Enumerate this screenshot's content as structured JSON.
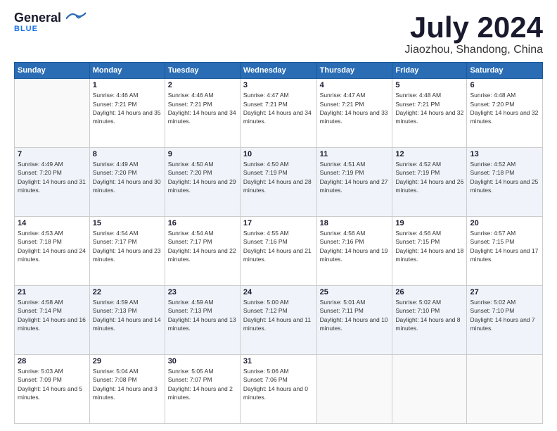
{
  "header": {
    "logo_general": "General",
    "logo_blue": "Blue",
    "month_title": "July 2024",
    "location": "Jiaozhou, Shandong, China"
  },
  "days_of_week": [
    "Sunday",
    "Monday",
    "Tuesday",
    "Wednesday",
    "Thursday",
    "Friday",
    "Saturday"
  ],
  "weeks": [
    [
      {
        "day": "",
        "sunrise": "",
        "sunset": "",
        "daylight": "",
        "empty": true
      },
      {
        "day": "1",
        "sunrise": "Sunrise: 4:46 AM",
        "sunset": "Sunset: 7:21 PM",
        "daylight": "Daylight: 14 hours and 35 minutes."
      },
      {
        "day": "2",
        "sunrise": "Sunrise: 4:46 AM",
        "sunset": "Sunset: 7:21 PM",
        "daylight": "Daylight: 14 hours and 34 minutes."
      },
      {
        "day": "3",
        "sunrise": "Sunrise: 4:47 AM",
        "sunset": "Sunset: 7:21 PM",
        "daylight": "Daylight: 14 hours and 34 minutes."
      },
      {
        "day": "4",
        "sunrise": "Sunrise: 4:47 AM",
        "sunset": "Sunset: 7:21 PM",
        "daylight": "Daylight: 14 hours and 33 minutes."
      },
      {
        "day": "5",
        "sunrise": "Sunrise: 4:48 AM",
        "sunset": "Sunset: 7:21 PM",
        "daylight": "Daylight: 14 hours and 32 minutes."
      },
      {
        "day": "6",
        "sunrise": "Sunrise: 4:48 AM",
        "sunset": "Sunset: 7:20 PM",
        "daylight": "Daylight: 14 hours and 32 minutes."
      }
    ],
    [
      {
        "day": "7",
        "sunrise": "Sunrise: 4:49 AM",
        "sunset": "Sunset: 7:20 PM",
        "daylight": "Daylight: 14 hours and 31 minutes."
      },
      {
        "day": "8",
        "sunrise": "Sunrise: 4:49 AM",
        "sunset": "Sunset: 7:20 PM",
        "daylight": "Daylight: 14 hours and 30 minutes."
      },
      {
        "day": "9",
        "sunrise": "Sunrise: 4:50 AM",
        "sunset": "Sunset: 7:20 PM",
        "daylight": "Daylight: 14 hours and 29 minutes."
      },
      {
        "day": "10",
        "sunrise": "Sunrise: 4:50 AM",
        "sunset": "Sunset: 7:19 PM",
        "daylight": "Daylight: 14 hours and 28 minutes."
      },
      {
        "day": "11",
        "sunrise": "Sunrise: 4:51 AM",
        "sunset": "Sunset: 7:19 PM",
        "daylight": "Daylight: 14 hours and 27 minutes."
      },
      {
        "day": "12",
        "sunrise": "Sunrise: 4:52 AM",
        "sunset": "Sunset: 7:19 PM",
        "daylight": "Daylight: 14 hours and 26 minutes."
      },
      {
        "day": "13",
        "sunrise": "Sunrise: 4:52 AM",
        "sunset": "Sunset: 7:18 PM",
        "daylight": "Daylight: 14 hours and 25 minutes."
      }
    ],
    [
      {
        "day": "14",
        "sunrise": "Sunrise: 4:53 AM",
        "sunset": "Sunset: 7:18 PM",
        "daylight": "Daylight: 14 hours and 24 minutes."
      },
      {
        "day": "15",
        "sunrise": "Sunrise: 4:54 AM",
        "sunset": "Sunset: 7:17 PM",
        "daylight": "Daylight: 14 hours and 23 minutes."
      },
      {
        "day": "16",
        "sunrise": "Sunrise: 4:54 AM",
        "sunset": "Sunset: 7:17 PM",
        "daylight": "Daylight: 14 hours and 22 minutes."
      },
      {
        "day": "17",
        "sunrise": "Sunrise: 4:55 AM",
        "sunset": "Sunset: 7:16 PM",
        "daylight": "Daylight: 14 hours and 21 minutes."
      },
      {
        "day": "18",
        "sunrise": "Sunrise: 4:56 AM",
        "sunset": "Sunset: 7:16 PM",
        "daylight": "Daylight: 14 hours and 19 minutes."
      },
      {
        "day": "19",
        "sunrise": "Sunrise: 4:56 AM",
        "sunset": "Sunset: 7:15 PM",
        "daylight": "Daylight: 14 hours and 18 minutes."
      },
      {
        "day": "20",
        "sunrise": "Sunrise: 4:57 AM",
        "sunset": "Sunset: 7:15 PM",
        "daylight": "Daylight: 14 hours and 17 minutes."
      }
    ],
    [
      {
        "day": "21",
        "sunrise": "Sunrise: 4:58 AM",
        "sunset": "Sunset: 7:14 PM",
        "daylight": "Daylight: 14 hours and 16 minutes."
      },
      {
        "day": "22",
        "sunrise": "Sunrise: 4:59 AM",
        "sunset": "Sunset: 7:13 PM",
        "daylight": "Daylight: 14 hours and 14 minutes."
      },
      {
        "day": "23",
        "sunrise": "Sunrise: 4:59 AM",
        "sunset": "Sunset: 7:13 PM",
        "daylight": "Daylight: 14 hours and 13 minutes."
      },
      {
        "day": "24",
        "sunrise": "Sunrise: 5:00 AM",
        "sunset": "Sunset: 7:12 PM",
        "daylight": "Daylight: 14 hours and 11 minutes."
      },
      {
        "day": "25",
        "sunrise": "Sunrise: 5:01 AM",
        "sunset": "Sunset: 7:11 PM",
        "daylight": "Daylight: 14 hours and 10 minutes."
      },
      {
        "day": "26",
        "sunrise": "Sunrise: 5:02 AM",
        "sunset": "Sunset: 7:10 PM",
        "daylight": "Daylight: 14 hours and 8 minutes."
      },
      {
        "day": "27",
        "sunrise": "Sunrise: 5:02 AM",
        "sunset": "Sunset: 7:10 PM",
        "daylight": "Daylight: 14 hours and 7 minutes."
      }
    ],
    [
      {
        "day": "28",
        "sunrise": "Sunrise: 5:03 AM",
        "sunset": "Sunset: 7:09 PM",
        "daylight": "Daylight: 14 hours and 5 minutes."
      },
      {
        "day": "29",
        "sunrise": "Sunrise: 5:04 AM",
        "sunset": "Sunset: 7:08 PM",
        "daylight": "Daylight: 14 hours and 3 minutes."
      },
      {
        "day": "30",
        "sunrise": "Sunrise: 5:05 AM",
        "sunset": "Sunset: 7:07 PM",
        "daylight": "Daylight: 14 hours and 2 minutes."
      },
      {
        "day": "31",
        "sunrise": "Sunrise: 5:06 AM",
        "sunset": "Sunset: 7:06 PM",
        "daylight": "Daylight: 14 hours and 0 minutes."
      },
      {
        "day": "",
        "sunrise": "",
        "sunset": "",
        "daylight": "",
        "empty": true
      },
      {
        "day": "",
        "sunrise": "",
        "sunset": "",
        "daylight": "",
        "empty": true
      },
      {
        "day": "",
        "sunrise": "",
        "sunset": "",
        "daylight": "",
        "empty": true
      }
    ]
  ]
}
